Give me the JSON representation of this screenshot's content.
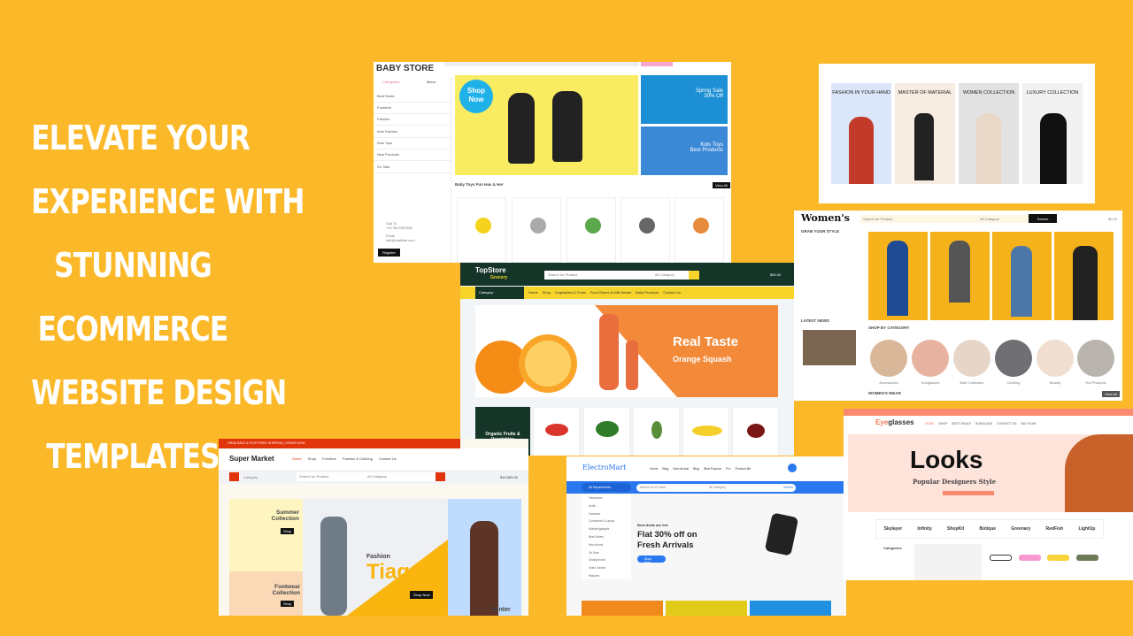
{
  "headline": {
    "lines": [
      "ELEVATE YOUR",
      "EXPERIENCE WITH",
      "STUNNING",
      "ECOMMERCE",
      "WEBSITE DESIGN",
      "TEMPLATES"
    ]
  },
  "colors": {
    "background": "#FBB829",
    "headline": "#FFFFFF"
  },
  "baby_store": {
    "logo": "BABY STORE",
    "tabs": [
      "Categories",
      "Menu"
    ],
    "menu": [
      "Best Deals",
      "Furniture",
      "Fashion",
      "Kids Fashion",
      "Kids Toys",
      "New Products",
      "On Sale"
    ],
    "hero_badge": "Shop Now",
    "promo1": [
      "Spring Sale",
      "30% Off"
    ],
    "promo2": [
      "Kids Toys",
      "Best Products"
    ],
    "section_title": "Baby Toys Fun Has & Her",
    "view_all": "View All",
    "contact": {
      "call_label": "Call To",
      "phone": "+12 9872357652",
      "email_label": "Email",
      "email": "info@mailsite.com"
    },
    "register": "Register"
  },
  "fashion": {
    "cards": [
      {
        "title": "FASHION IN YOUR HAND"
      },
      {
        "title": "MASTER OF MATERIAL"
      },
      {
        "title": "WOMEN COLLECTION"
      },
      {
        "title": "LUXURY COLLECTION"
      }
    ]
  },
  "womens": {
    "logo": "Women's",
    "search_placeholder": "Search for Product",
    "category": "All Category",
    "search_button": "Search",
    "cart": "$0.00",
    "grab_title": "GRAB YOUR STYLE",
    "latest": "LATEST NEWS",
    "shop_by": "SHOP BY CATEGORY",
    "womens_wear": "WOMEN'S WEAR",
    "view_all": "View All",
    "categories": [
      "Accessories",
      "Sunglasses",
      "Bath Collection",
      "Clothing",
      "Beauty",
      "Hot Products"
    ]
  },
  "topstore": {
    "logo": "TopStore",
    "sub": "Grocery",
    "search_placeholder": "Search for Product",
    "category": "All Category",
    "cart": "$00.00",
    "category_btn": "Category",
    "nav": [
      "Home",
      "Shop",
      "Vegetables & Fruits",
      "Food Stores & Milk Needs",
      "Baby Products",
      "Contact Us"
    ],
    "hero_title": "Real Taste",
    "hero_sub": "Orange Squash",
    "side": "Organic Fruits & Vegetables"
  },
  "supermarket": {
    "topbar": "GRAB SALE & STOP! FREE SHIPPING | ORDER NOW",
    "logo": "Super Market",
    "nav": [
      "Home",
      "Shop",
      "Furniture",
      "Fashion & Clothing",
      "Contact Us"
    ],
    "category": "Category",
    "search_placeholder": "Search for Product",
    "all_category": "All Category",
    "cart": "$15,569.00",
    "summer": "Summer Collection",
    "footwear": "Footwear Collection",
    "shop": "Shop",
    "fashion": "Fashion",
    "tiago": "Tiago",
    "shop_now": "Shop Now",
    "winter": "Winter"
  },
  "electromart": {
    "logo": "ElectroMart",
    "nav": [
      "Home",
      "Blog",
      "New Arrival",
      "Blog",
      "Best Popular",
      "Pro",
      "Product-life"
    ],
    "departments": "All Departments",
    "search_placeholder": "Search for Product",
    "all_category": "All Category",
    "search": "Search",
    "menu": [
      "Televisions",
      "Audio",
      "Cameras",
      "Computers & Laptop",
      "Mobiles/gadgets",
      "Best Sellers",
      "New Arrival",
      "On Sale",
      "Smartphones",
      "Video Games",
      "Watches"
    ],
    "deal": "Best deals are live",
    "hero": "Flat 30% off on Fresh Arrivals",
    "cta": "Shop Now"
  },
  "eyeglasses": {
    "logo_a": "Eye",
    "logo_b": "glasses",
    "nav": [
      "HOME",
      "SHOP",
      "BEST DEALS",
      "SUNGLASS",
      "CONTACT US",
      "BUY NOW"
    ],
    "hero_title": "Looks",
    "hero_sub": "Popular Designers Style",
    "brands": [
      "Skylayer",
      "Infinity",
      "ShopKit",
      "Botique",
      "Greenary",
      "RedFish",
      "LightUp"
    ],
    "categories": "Categories"
  }
}
